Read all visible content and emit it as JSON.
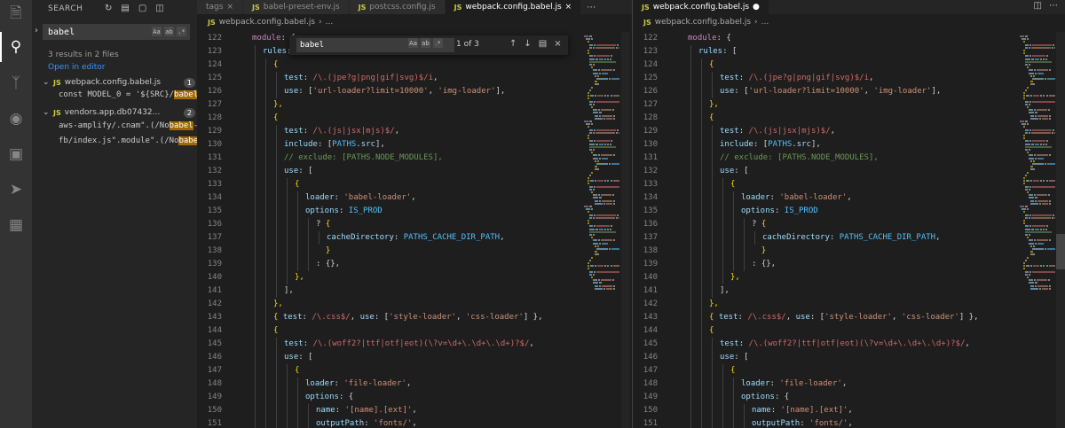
{
  "sidebar": {
    "title": "SEARCH",
    "search_query": "babel",
    "results_info": "3 results in 2 files",
    "open_in_editor": "Open in editor",
    "files": [
      {
        "name": "webpack.config.babel.js",
        "count": "1",
        "matches": [
          {
            "before": "const MODEL_0 = '${SRC}/",
            "match": "babel",
            "after": ""
          }
        ]
      },
      {
        "name": "vendors.app.db07432...",
        "count": "2",
        "matches": [
          {
            "before": "aws-amplify/.cnam\".(/No",
            "match": "babel",
            "after": "-..."
          },
          {
            "before": "fb/index.js\".module\".(/No",
            "match": "babel",
            "after": "-..."
          }
        ]
      }
    ]
  },
  "left_group": {
    "tabs": [
      {
        "label": "tags",
        "active": false
      },
      {
        "label": "babel-preset-env.js",
        "active": false
      },
      {
        "label": "postcss.config.js",
        "active": false
      },
      {
        "label": "webpack.config.babel.js",
        "active": true
      }
    ],
    "breadcrumb": [
      "webpack.config.babel.js",
      "..."
    ]
  },
  "right_group": {
    "tabs": [
      {
        "label": "webpack.config.babel.js",
        "active": true
      }
    ],
    "breadcrumb": [
      "webpack.config.babel.js",
      "..."
    ]
  },
  "find": {
    "query": "babel",
    "count": "1 of 3"
  },
  "code_lines": [
    {
      "n": "122",
      "indent": 0,
      "parts": [
        [
          "kw",
          "module"
        ],
        [
          "pun",
          ": {"
        ]
      ]
    },
    {
      "n": "123",
      "indent": 1,
      "parts": [
        [
          "prop",
          "rules"
        ],
        [
          "pun",
          ": ["
        ]
      ]
    },
    {
      "n": "124",
      "indent": 2,
      "parts": [
        [
          "brk",
          "{"
        ]
      ]
    },
    {
      "n": "125",
      "indent": 3,
      "parts": [
        [
          "prop",
          "test"
        ],
        [
          "pun",
          ": "
        ],
        [
          "rx",
          "/\\.(jpe?g|png|gif|svg)$/i"
        ],
        [
          "pun",
          ","
        ]
      ]
    },
    {
      "n": "126",
      "indent": 3,
      "parts": [
        [
          "prop",
          "use"
        ],
        [
          "pun",
          ": ["
        ],
        [
          "str",
          "'url-loader?limit=10000'"
        ],
        [
          "pun",
          ", "
        ],
        [
          "str",
          "'img-loader'"
        ],
        [
          "pun",
          "],"
        ]
      ]
    },
    {
      "n": "127",
      "indent": 2,
      "parts": [
        [
          "brk",
          "},"
        ]
      ]
    },
    {
      "n": "128",
      "indent": 2,
      "parts": [
        [
          "brk",
          "{"
        ]
      ]
    },
    {
      "n": "129",
      "indent": 3,
      "parts": [
        [
          "prop",
          "test"
        ],
        [
          "pun",
          ": "
        ],
        [
          "rx",
          "/\\.(js|jsx|mjs)$/"
        ],
        [
          "pun",
          ","
        ]
      ]
    },
    {
      "n": "130",
      "indent": 3,
      "parts": [
        [
          "prop",
          "include"
        ],
        [
          "pun",
          ": ["
        ],
        [
          "con",
          "PATHS"
        ],
        [
          "pun",
          "."
        ],
        [
          "prop",
          "src"
        ],
        [
          "pun",
          "],"
        ]
      ]
    },
    {
      "n": "131",
      "indent": 3,
      "parts": [
        [
          "cm",
          "// exclude: [PATHS.NODE_MODULES],"
        ]
      ]
    },
    {
      "n": "132",
      "indent": 3,
      "parts": [
        [
          "prop",
          "use"
        ],
        [
          "pun",
          ": ["
        ]
      ]
    },
    {
      "n": "133",
      "indent": 4,
      "parts": [
        [
          "brk",
          "{"
        ]
      ]
    },
    {
      "n": "134",
      "indent": 5,
      "parts": [
        [
          "prop",
          "loader"
        ],
        [
          "pun",
          ": "
        ],
        [
          "str",
          "'babel-loader'"
        ],
        [
          "pun",
          ","
        ]
      ]
    },
    {
      "n": "135",
      "indent": 5,
      "parts": [
        [
          "prop",
          "options"
        ],
        [
          "pun",
          ": "
        ],
        [
          "con",
          "IS_PROD"
        ]
      ]
    },
    {
      "n": "136",
      "indent": 6,
      "parts": [
        [
          "pun",
          "? "
        ],
        [
          "brk",
          "{"
        ]
      ]
    },
    {
      "n": "137",
      "indent": 7,
      "parts": [
        [
          "prop",
          "cacheDirectory"
        ],
        [
          "pun",
          ": "
        ],
        [
          "con",
          "PATHS_CACHE_DIR_PATH"
        ],
        [
          "pun",
          ","
        ]
      ]
    },
    {
      "n": "138",
      "indent": 6,
      "parts": [
        [
          "brk",
          "  }"
        ]
      ]
    },
    {
      "n": "139",
      "indent": 6,
      "parts": [
        [
          "pun",
          ": {},"
        ]
      ]
    },
    {
      "n": "140",
      "indent": 4,
      "parts": [
        [
          "brk",
          "},"
        ]
      ]
    },
    {
      "n": "141",
      "indent": 3,
      "parts": [
        [
          "pun",
          "],"
        ]
      ]
    },
    {
      "n": "142",
      "indent": 2,
      "parts": [
        [
          "brk",
          "},"
        ]
      ]
    },
    {
      "n": "143",
      "indent": 2,
      "parts": [
        [
          "brk",
          "{ "
        ],
        [
          "prop",
          "test"
        ],
        [
          "pun",
          ": "
        ],
        [
          "rx",
          "/\\.css$/"
        ],
        [
          "pun",
          ", "
        ],
        [
          "prop",
          "use"
        ],
        [
          "pun",
          ": ["
        ],
        [
          "str",
          "'style-loader'"
        ],
        [
          "pun",
          ", "
        ],
        [
          "str",
          "'css-loader'"
        ],
        [
          "pun",
          "] },"
        ]
      ]
    },
    {
      "n": "144",
      "indent": 2,
      "parts": [
        [
          "brk",
          "{"
        ]
      ]
    },
    {
      "n": "145",
      "indent": 3,
      "parts": [
        [
          "prop",
          "test"
        ],
        [
          "pun",
          ": "
        ],
        [
          "rx",
          "/\\.(woff2?|ttf|otf|eot)(\\?v=\\d+\\.\\d+\\.\\d+)?$/"
        ],
        [
          "pun",
          ","
        ]
      ]
    },
    {
      "n": "146",
      "indent": 3,
      "parts": [
        [
          "prop",
          "use"
        ],
        [
          "pun",
          ": ["
        ]
      ]
    },
    {
      "n": "147",
      "indent": 4,
      "parts": [
        [
          "brk",
          "{"
        ]
      ]
    },
    {
      "n": "148",
      "indent": 5,
      "parts": [
        [
          "prop",
          "loader"
        ],
        [
          "pun",
          ": "
        ],
        [
          "str",
          "'file-loader'"
        ],
        [
          "pun",
          ","
        ]
      ]
    },
    {
      "n": "149",
      "indent": 5,
      "parts": [
        [
          "prop",
          "options"
        ],
        [
          "pun",
          ": {"
        ]
      ]
    },
    {
      "n": "150",
      "indent": 6,
      "parts": [
        [
          "prop",
          "name"
        ],
        [
          "pun",
          ": "
        ],
        [
          "str",
          "'[name].[ext]'"
        ],
        [
          "pun",
          ","
        ]
      ]
    },
    {
      "n": "151",
      "indent": 6,
      "parts": [
        [
          "prop",
          "outputPath"
        ],
        [
          "pun",
          ": "
        ],
        [
          "str",
          "'fonts/'"
        ],
        [
          "pun",
          ","
        ]
      ]
    }
  ],
  "colors": {
    "match_highlight": "#9e6a03",
    "accent": "#3794ff"
  }
}
